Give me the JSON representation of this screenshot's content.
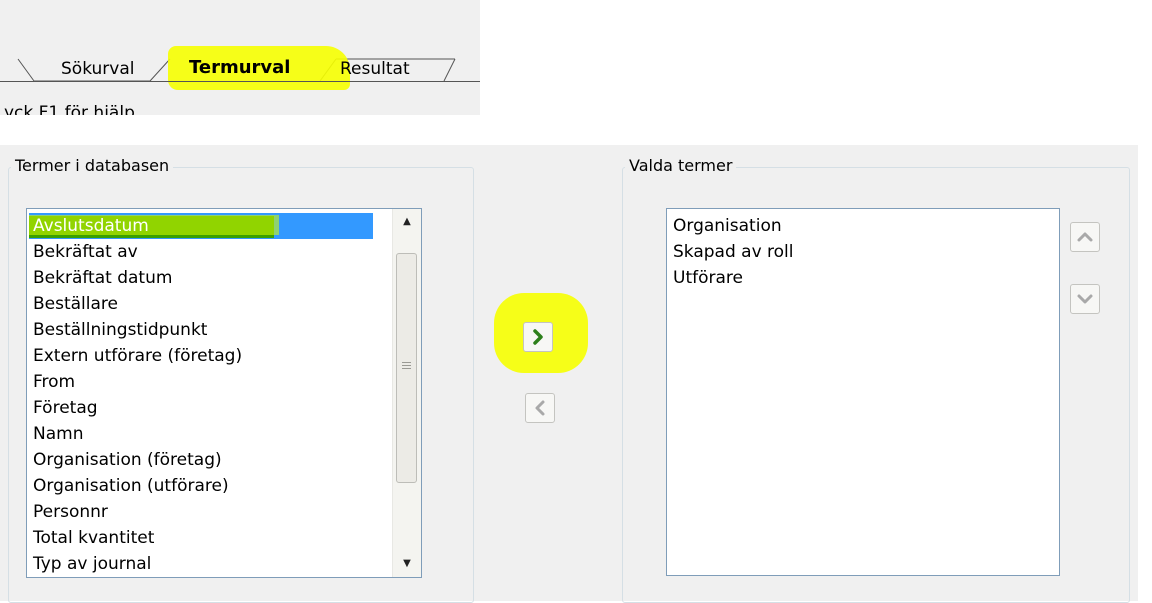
{
  "tabs": [
    {
      "label": "Sökurval",
      "active": false
    },
    {
      "label": "Termurval",
      "active": true
    },
    {
      "label": "Resultat",
      "active": false
    }
  ],
  "status_hint": "yck F1 för hjälp",
  "left_group": {
    "title": "Termer i databasen",
    "items": [
      "Avslutsdatum",
      "Bekräftat av",
      "Bekräftat datum",
      "Beställare",
      "Beställningstidpunkt",
      "Extern utförare (företag)",
      "From",
      "Företag",
      "Namn",
      "Organisation (företag)",
      "Organisation (utförare)",
      "Personnr",
      "Total kvantitet",
      "Typ av journal"
    ],
    "selected_item": "Avslutsdatum"
  },
  "right_group": {
    "title": "Valda termer",
    "items": [
      "Organisation",
      "Skapad av roll",
      "Utförare"
    ]
  },
  "icons": {
    "add": "chevron-right-icon",
    "remove": "chevron-left-icon",
    "move_up": "chevron-up-icon",
    "move_down": "chevron-down-icon"
  },
  "colors": {
    "selection": "#3399ff",
    "highlighter_yellow": "#f6ff00",
    "highlighter_green": "#3aa000",
    "add_arrow": "#2d7f1b"
  }
}
